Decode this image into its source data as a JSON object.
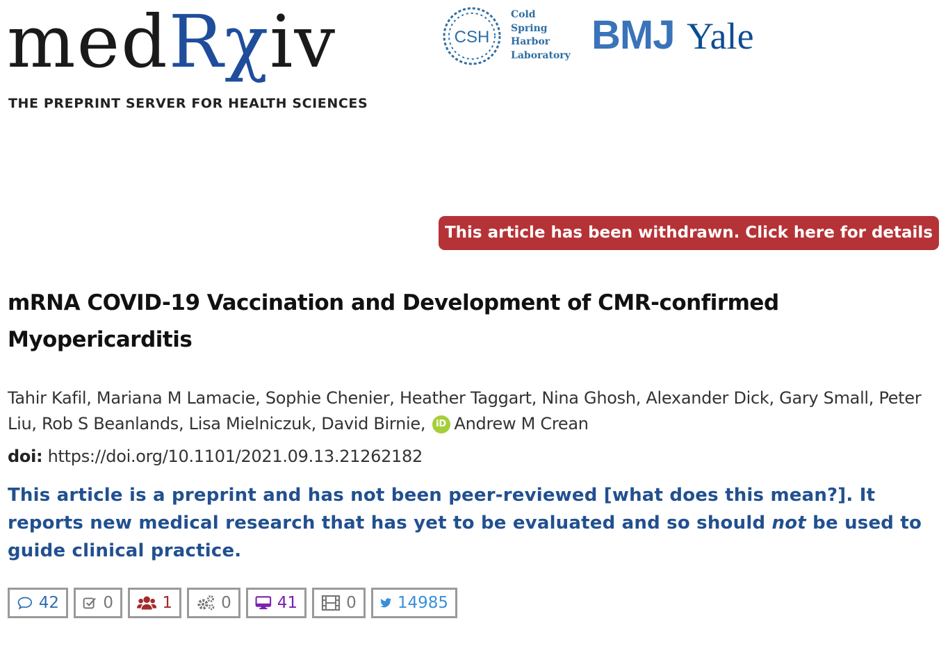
{
  "header": {
    "logo_med": "med",
    "logo_rx": "Rχ",
    "logo_iv": "iv",
    "tagline": "THE PREPRINT SERVER FOR HEALTH SCIENCES",
    "csh_abbr": "CSH",
    "csh_lines": [
      "Cold",
      "Spring",
      "Harbor",
      "Laboratory"
    ],
    "bmj": "BMJ",
    "yale": "Yale"
  },
  "notice": {
    "withdrawn": "This article has been withdrawn. Click here for details"
  },
  "article": {
    "title": "mRNA COVID-19 Vaccination and Development of CMR-confirmed Myopericarditis",
    "authors_before": "Tahir Kafil, Mariana M Lamacie, Sophie Chenier, Heather Taggart, Nina Ghosh, Alexander Dick, Gary Small, Peter Liu, Rob S Beanlands, Lisa Mielniczuk, David Birnie,",
    "orcid_label": "iD",
    "authors_last": "Andrew M Crean",
    "doi_label": "doi:",
    "doi_value": "https://doi.org/10.1101/2021.09.13.21262182",
    "preprint_part1": "This article is a preprint and has not been peer-reviewed ",
    "preprint_link": "[what does this mean?]",
    "preprint_part2": ". It reports new medical research that has yet to be evaluated and so should ",
    "preprint_not": "not",
    "preprint_part3": " be used to guide clinical practice."
  },
  "metrics": [
    {
      "icon": "comment-icon",
      "value": "42",
      "color": "#2f6db5"
    },
    {
      "icon": "checkbox-icon",
      "value": "0",
      "color": "#777777"
    },
    {
      "icon": "users-icon",
      "value": "1",
      "color": "#a52a2a"
    },
    {
      "icon": "gears-icon",
      "value": "0",
      "color": "#777777"
    },
    {
      "icon": "monitor-icon",
      "value": "41",
      "color": "#7a1fb3"
    },
    {
      "icon": "film-icon",
      "value": "0",
      "color": "#777777"
    },
    {
      "icon": "twitter-icon",
      "value": "14985",
      "color": "#3b8fd9"
    }
  ]
}
